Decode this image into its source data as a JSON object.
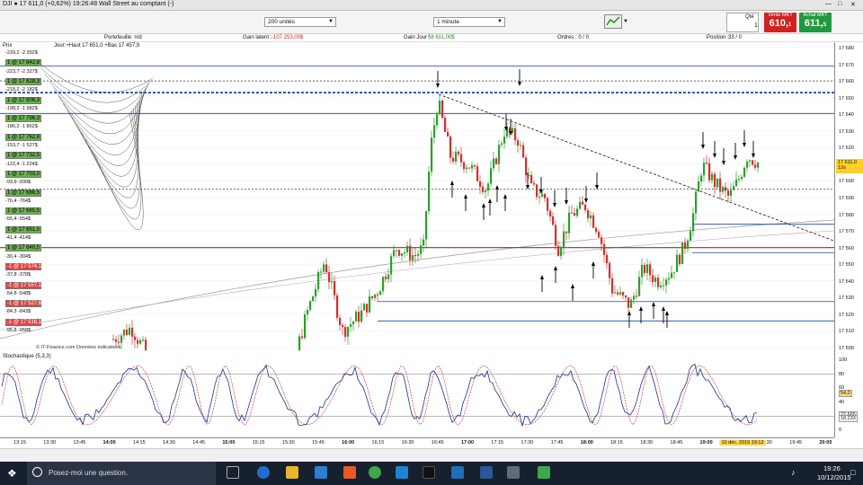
{
  "window": {
    "title": "DJI ● 17 611,0 (+0,62%) 19:26:48 Wall Street au comptant (-)"
  },
  "toolbar": {
    "duration_select": "200 unités",
    "interval_select": "1 minute",
    "qty_label": "Qté",
    "qty_value": "1",
    "sell_label": "Vente MKT",
    "sell_price": "610,",
    "sell_small": "1",
    "buy_label": "Achat MKT",
    "buy_price": "611,",
    "buy_small": "5"
  },
  "infobar": {
    "portefeuille": "Portefeuille: n/d",
    "gain_latent_label": "Gain latent :",
    "gain_latent_value": "-107 253,00$",
    "gain_jour_label": "Gain Jour :",
    "gain_jour_value": "58 611,00$",
    "ordres": "Ordres : 0 / 0",
    "position_label": "Position :",
    "position_value": "33 / 0"
  },
  "chart_header": {
    "prix": "Prix",
    "jour": "Jour:+Haut 17 651,0 +Bas 17 457,9"
  },
  "orders": [
    {
      "text": "-239,2  -2 392$",
      "kind": "pl"
    },
    {
      "text": "1 @ 17 842,8",
      "kind": "buy"
    },
    {
      "text": "-223,7  -2 327$",
      "kind": "pl"
    },
    {
      "text": "1 @ 17 828,3",
      "kind": "buy"
    },
    {
      "text": "-218,2  -2 182$",
      "kind": "pl"
    },
    {
      "text": "1 @ 17 808,3",
      "kind": "buy"
    },
    {
      "text": "-198,2  -1 982$",
      "kind": "pl"
    },
    {
      "text": "1 @ 17 796,3",
      "kind": "buy"
    },
    {
      "text": "-186,2  -1 862$",
      "kind": "pl"
    },
    {
      "text": "1 @ 17 762,8",
      "kind": "buy"
    },
    {
      "text": "-153,7  -1 527$",
      "kind": "pl"
    },
    {
      "text": "1 @ 17 732,5",
      "kind": "buy"
    },
    {
      "text": "-122,4  -1 224$",
      "kind": "pl"
    },
    {
      "text": "1 @ 17 703,0",
      "kind": "buy"
    },
    {
      "text": "-93,9  -939$",
      "kind": "pl"
    },
    {
      "text": "1 @ 17 686,5",
      "kind": "buy"
    },
    {
      "text": "-76,4  -764$",
      "kind": "pl"
    },
    {
      "text": "1 @ 17 665,5",
      "kind": "buy"
    },
    {
      "text": "-55,4  -554$",
      "kind": "pl"
    },
    {
      "text": "1 @ 17 651,5",
      "kind": "buy"
    },
    {
      "text": "-41,4  -414$",
      "kind": "pl"
    },
    {
      "text": "1 @ 17 640,5",
      "kind": "buy"
    },
    {
      "text": "-30,4  -304$",
      "kind": "pl"
    },
    {
      "text": "-1 @ 17 574,1",
      "kind": "sell"
    },
    {
      "text": "-37,8  -378$",
      "kind": "pl"
    },
    {
      "text": "-1 @ 17 557,1",
      "kind": "sell"
    },
    {
      "text": "-54,8  -548$",
      "kind": "pl"
    },
    {
      "text": "-1 @ 17 527,6",
      "kind": "sell"
    },
    {
      "text": "-84,3  -843$",
      "kind": "pl"
    },
    {
      "text": "-1 @ 17 516,1",
      "kind": "sell"
    },
    {
      "text": "-95,8  -958$",
      "kind": "pl"
    }
  ],
  "price_axis": [
    "17 680",
    "17 670",
    "17 660",
    "17 650",
    "17 640",
    "17 630",
    "17 620",
    "17 610",
    "17 600",
    "17 590",
    "17 580",
    "17 570",
    "17 560",
    "17 550",
    "17 540",
    "17 530",
    "17 520",
    "17 510",
    "17 500"
  ],
  "current_price_tag": "17 611,0",
  "current_price_sub": "12s",
  "stoch_axis": [
    "100",
    "80",
    "60",
    "40",
    "20",
    "0"
  ],
  "stoch_tags": [
    "54,0",
    "22,665",
    "18,233"
  ],
  "stoch_label": "Stochastique (5,3,3)",
  "watermark": "© IT-Finance.com Données indicatives",
  "time_axis": [
    "13:15",
    "13:30",
    "13:45",
    "14:00",
    "14:15",
    "14:30",
    "14:45",
    "15:00",
    "15:15",
    "15:30",
    "15:45",
    "16:00",
    "16:15",
    "16:30",
    "16:45",
    "17:00",
    "17:15",
    "17:30",
    "17:45",
    "18:00",
    "18:15",
    "18:30",
    "18:45",
    "19:00",
    "19:15",
    "19:30",
    "19:45",
    "20:00"
  ],
  "cursor_time": "10 déc. 2015 19:12",
  "taskbar": {
    "search_placeholder": "Posez-moi une question.",
    "time": "19:26",
    "date": "10/12/2015"
  },
  "colors": {
    "up": "#2e9e2e",
    "down": "#d32f2f",
    "hline_blue": "#1f3fb0",
    "hline_brown": "#8b3a1a",
    "stoch_main": "#1f2f8f",
    "stoch_signal": "#d04040"
  }
}
